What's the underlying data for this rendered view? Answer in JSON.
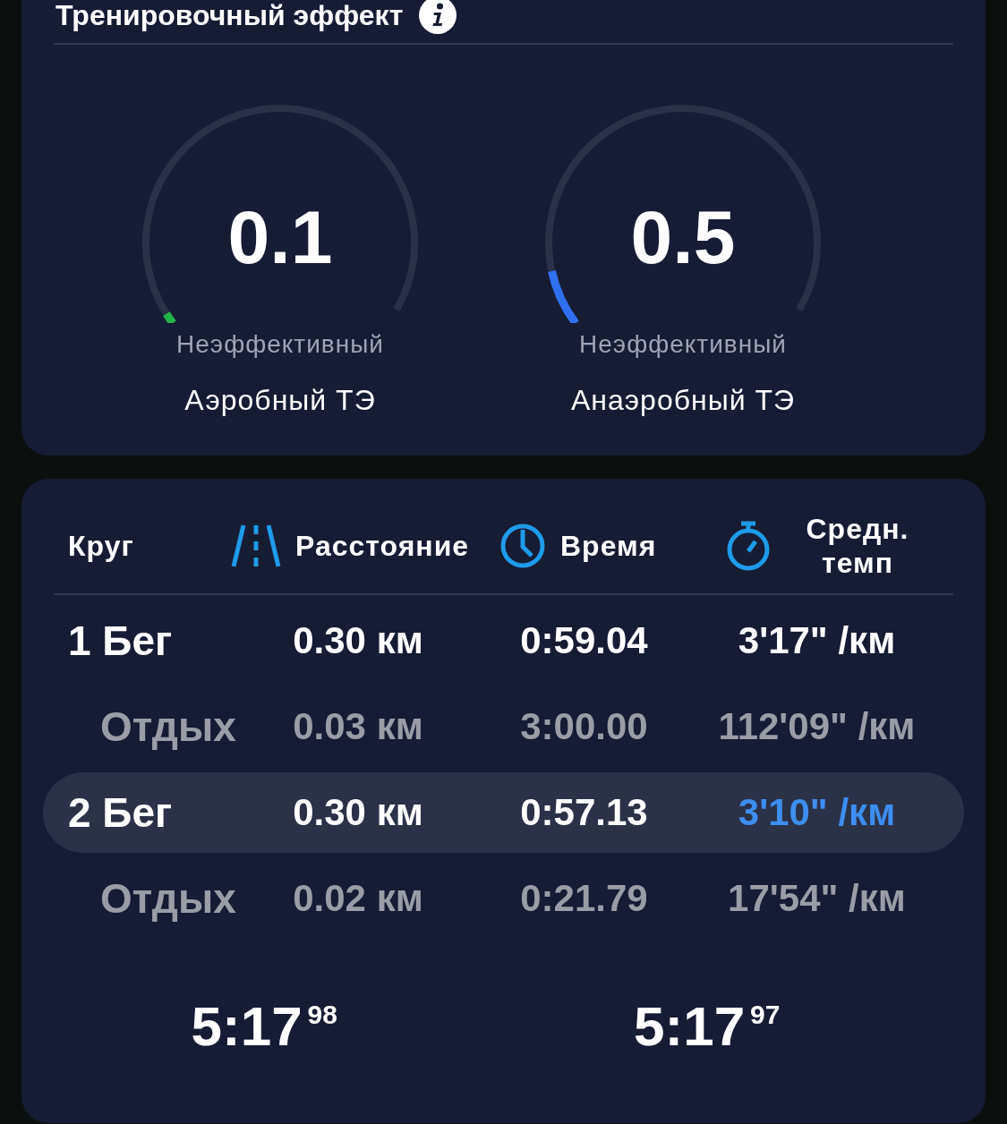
{
  "training_effect": {
    "title": "Тренировочный эффект",
    "gauges": [
      {
        "value": "0.1",
        "rating": "Неэффективный",
        "label": "Аэробный ТЭ",
        "color": "#22b24c"
      },
      {
        "value": "0.5",
        "rating": "Неэффективный",
        "label": "Анаэробный ТЭ",
        "color": "#2f6ff0"
      }
    ]
  },
  "laps": {
    "columns": [
      {
        "label": "Круг"
      },
      {
        "label": "Расстояние"
      },
      {
        "label": "Время"
      },
      {
        "label": "Средн. темп"
      }
    ],
    "rows": [
      {
        "kind": "lap",
        "lap": "1 Бег",
        "distance": "0.30 км",
        "time": "0:59.04",
        "pace": "3'17\" /км",
        "selected": false
      },
      {
        "kind": "rest",
        "lap": "Отдых",
        "distance": "0.03 км",
        "time": "3:00.00",
        "pace": "112'09\" /км",
        "selected": false
      },
      {
        "kind": "lap",
        "lap": "2 Бег",
        "distance": "0.30 км",
        "time": "0:57.13",
        "pace": "3'10\" /км",
        "selected": true
      },
      {
        "kind": "rest",
        "lap": "Отдых",
        "distance": "0.02 км",
        "time": "0:21.79",
        "pace": "17'54\" /км",
        "selected": false
      }
    ],
    "totals": [
      "5:17$^{98}$",
      "5:17$^{97}$"
    ]
  }
}
